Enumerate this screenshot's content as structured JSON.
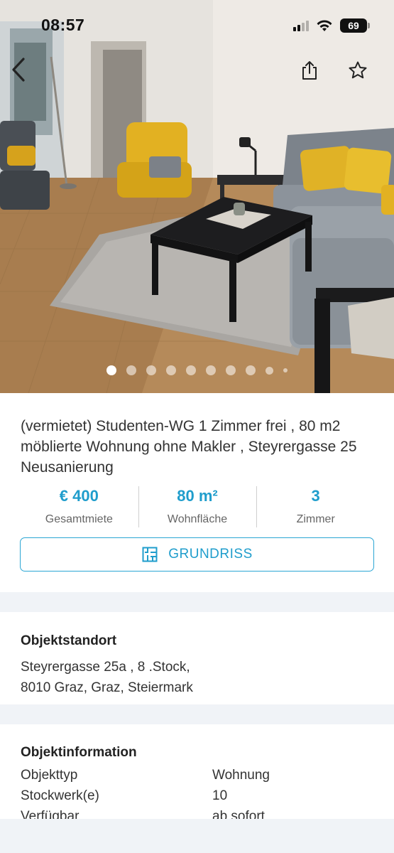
{
  "status_bar": {
    "time": "08:57",
    "battery": "69",
    "icons": [
      "signal-icon",
      "wifi-icon",
      "battery-icon"
    ]
  },
  "gallery": {
    "image_subject": "living-room-photo",
    "total_photos": 10,
    "active_index": 0
  },
  "nav": {
    "icons": [
      "chevron-left-icon",
      "share-icon",
      "star-icon"
    ]
  },
  "listing": {
    "title": "(vermietet) Studenten-WG 1 Zimmer frei , 80 m2 möblierte Wohnung  ohne Makler  , Steyrergasse 25 Neusanierung",
    "stats": [
      {
        "value": "€ 400",
        "label": "Gesamtmiete"
      },
      {
        "value": "80 m²",
        "label": "Wohnfläche"
      },
      {
        "value": "3",
        "label": "Zimmer"
      }
    ],
    "grundriss_label": "GRUNDRISS",
    "grundriss_icon": "floorplan-icon"
  },
  "location": {
    "heading": "Objektstandort",
    "line1": "Steyrergasse 25a , 8 .Stock,",
    "line2": "8010 Graz, Graz, Steiermark"
  },
  "info": {
    "heading": "Objektinformation",
    "rows": [
      {
        "key": "Objekttyp",
        "value": "Wohnung"
      },
      {
        "key": "Stockwerk(e)",
        "value": "10"
      },
      {
        "key": "Verfügbar",
        "value": "ab sofort"
      }
    ]
  },
  "colors": {
    "accent": "#1f9dcc",
    "separator": "#f0f3f7",
    "text": "#333333"
  }
}
